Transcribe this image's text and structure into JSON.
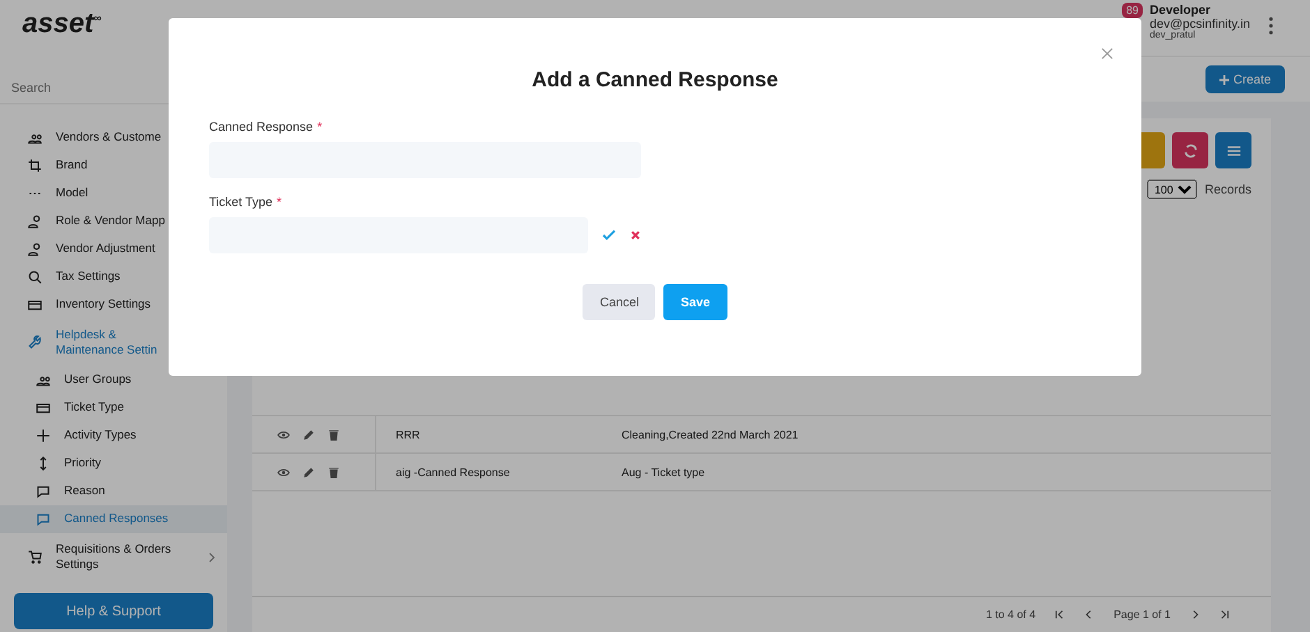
{
  "brand": {
    "logo": "asset",
    "logo_mark": "∞"
  },
  "sidebar": {
    "search_placeholder": "Search",
    "items": [
      {
        "label": "Vendors & Custome",
        "selected": false
      },
      {
        "label": "Brand",
        "selected": false
      },
      {
        "label": "Model",
        "selected": false
      },
      {
        "label": "Role & Vendor Mapp",
        "selected": false
      },
      {
        "label": "Vendor Adjustment",
        "selected": false
      },
      {
        "label": "Tax Settings",
        "selected": false
      },
      {
        "label": "Inventory Settings",
        "selected": false
      },
      {
        "label": "Helpdesk & Maintenance Settin",
        "selected": false,
        "expanded": true,
        "children": [
          {
            "label": "User Groups",
            "selected": false
          },
          {
            "label": "Ticket Type",
            "selected": false
          },
          {
            "label": "Activity Types",
            "selected": false
          },
          {
            "label": "Priority",
            "selected": false
          },
          {
            "label": "Reason",
            "selected": false
          },
          {
            "label": "Canned Responses",
            "selected": true
          }
        ]
      },
      {
        "label": "Requisitions & Orders Settings",
        "selected": false,
        "expanded": false
      }
    ],
    "help_button": "Help & Support"
  },
  "header": {
    "notification_count": "89",
    "user_name": "Developer",
    "user_email": "dev@pcsinfinity.in",
    "username": "dev_pratul",
    "create_button": "Create"
  },
  "table": {
    "page_size": "100",
    "records_label": "Records",
    "rows": [
      {
        "name": "RRR",
        "ticket_types": "Cleaning,Created 22nd March 2021"
      },
      {
        "name": "aig -Canned Response",
        "ticket_types": "Aug - Ticket type"
      }
    ],
    "pagination": {
      "range": "1 to 4 of 4",
      "page": "Page 1 of 1"
    }
  },
  "modal": {
    "title": "Add a Canned Response",
    "fields": [
      {
        "label": "Canned Response",
        "required_mark": "*",
        "kind": "text"
      },
      {
        "label": "Ticket Type",
        "required_mark": "*",
        "kind": "confirm"
      }
    ],
    "cancel_button": "Cancel",
    "save_button": "Save"
  }
}
